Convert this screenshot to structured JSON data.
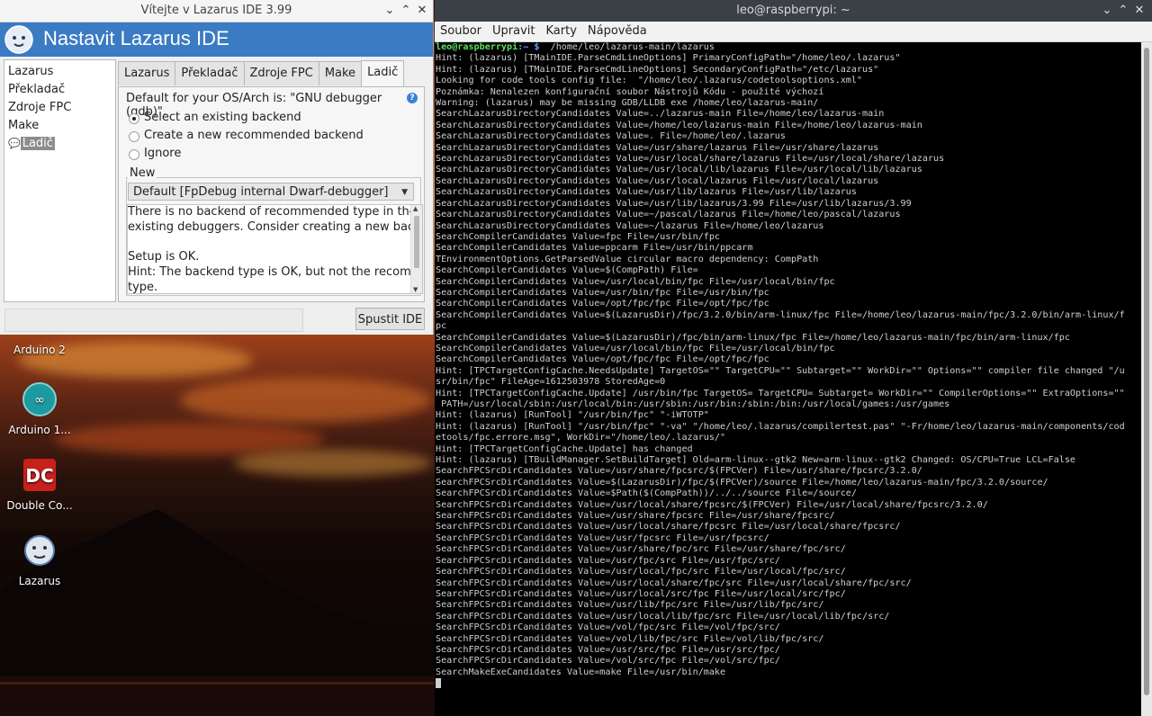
{
  "desktop": {
    "icons": [
      {
        "label": "Arduino 2",
        "icon": "arduino-icon"
      },
      {
        "label": "Arduino 1...",
        "icon": "arduino-icon"
      },
      {
        "label": "Double Co...",
        "icon": "double-commander-icon"
      },
      {
        "label": "Lazarus",
        "icon": "lazarus-cheetah-icon"
      }
    ]
  },
  "lazarus": {
    "window_title": "Vítejte v Lazarus IDE 3.99",
    "header_title": "Nastavit Lazarus IDE",
    "tree": [
      "Lazarus",
      "Překladač",
      "Zdroje FPC",
      "Make",
      "Ladič"
    ],
    "tabs": [
      "Lazarus",
      "Překladač",
      "Zdroje FPC",
      "Make",
      "Ladič"
    ],
    "default_debugger_text": "Default for your OS/Arch is: \"GNU debugger (gdb)\".",
    "radio_options": [
      "Select an existing backend",
      "Create a new recommended backend",
      "Ignore"
    ],
    "selected_radio": 0,
    "new_label": "New",
    "combo_value": "Default [FpDebug internal Dwarf-debugger]",
    "memo_lines": [
      "There is no backend of recommended type in the list of",
      "existing debuggers. Consider creating a new backend.",
      "",
      "Setup is OK.",
      "Hint: The backend type is OK, but not the recommended",
      "type."
    ],
    "run_button": "Spustit IDE",
    "colors": {
      "header_bg": "#3a7bc3",
      "help_icon": "#3b82d6"
    }
  },
  "terminal": {
    "window_title": "leo@raspberrypi: ~",
    "menu": [
      "Soubor",
      "Upravit",
      "Karty",
      "Nápověda"
    ],
    "prompt_user": "leo@raspberrypi",
    "prompt_dir": ":~ $",
    "command": "/home/leo/lazarus-main/lazarus",
    "lines": [
      "Hint: (lazarus) [TMainIDE.ParseCmdLineOptions] PrimaryConfigPath=\"/home/leo/.lazarus\"",
      "Hint: (lazarus) [TMainIDE.ParseCmdLineOptions] SecondaryConfigPath=\"/etc/lazarus\"",
      "Looking for code tools config file:  \"/home/leo/.lazarus/codetoolsoptions.xml\"",
      "Poznámka: Nenalezen konfigurační soubor Nástrojů Kódu - použité výchozí",
      "Warning: (lazarus) may be missing GDB/LLDB exe /home/leo/lazarus-main/",
      "SearchLazarusDirectoryCandidates Value=../lazarus-main File=/home/leo/lazarus-main",
      "SearchLazarusDirectoryCandidates Value=/home/leo/lazarus-main File=/home/leo/lazarus-main",
      "SearchLazarusDirectoryCandidates Value=. File=/home/leo/.lazarus",
      "SearchLazarusDirectoryCandidates Value=/usr/share/lazarus File=/usr/share/lazarus",
      "SearchLazarusDirectoryCandidates Value=/usr/local/share/lazarus File=/usr/local/share/lazarus",
      "SearchLazarusDirectoryCandidates Value=/usr/local/lib/lazarus File=/usr/local/lib/lazarus",
      "SearchLazarusDirectoryCandidates Value=/usr/local/lazarus File=/usr/local/lazarus",
      "SearchLazarusDirectoryCandidates Value=/usr/lib/lazarus File=/usr/lib/lazarus",
      "SearchLazarusDirectoryCandidates Value=/usr/lib/lazarus/3.99 File=/usr/lib/lazarus/3.99",
      "SearchLazarusDirectoryCandidates Value=~/pascal/lazarus File=/home/leo/pascal/lazarus",
      "SearchLazarusDirectoryCandidates Value=~/lazarus File=/home/leo/lazarus",
      "SearchCompilerCandidates Value=fpc File=/usr/bin/fpc",
      "SearchCompilerCandidates Value=ppcarm File=/usr/bin/ppcarm",
      "TEnvironmentOptions.GetParsedValue circular macro dependency: CompPath",
      "SearchCompilerCandidates Value=$(CompPath) File=",
      "SearchCompilerCandidates Value=/usr/local/bin/fpc File=/usr/local/bin/fpc",
      "SearchCompilerCandidates Value=/usr/bin/fpc File=/usr/bin/fpc",
      "SearchCompilerCandidates Value=/opt/fpc/fpc File=/opt/fpc/fpc",
      "SearchCompilerCandidates Value=$(LazarusDir)/fpc/3.2.0/bin/arm-linux/fpc File=/home/leo/lazarus-main/fpc/3.2.0/bin/arm-linux/f",
      "pc",
      "SearchCompilerCandidates Value=$(LazarusDir)/fpc/bin/arm-linux/fpc File=/home/leo/lazarus-main/fpc/bin/arm-linux/fpc",
      "SearchCompilerCandidates Value=/usr/local/bin/fpc File=/usr/local/bin/fpc",
      "SearchCompilerCandidates Value=/opt/fpc/fpc File=/opt/fpc/fpc",
      "Hint: [TPCTargetConfigCache.NeedsUpdate] TargetOS=\"\" TargetCPU=\"\" Subtarget=\"\" WorkDir=\"\" Options=\"\" compiler file changed \"/u",
      "sr/bin/fpc\" FileAge=1612503978 StoredAge=0",
      "Hint: [TPCTargetConfigCache.Update] /usr/bin/fpc TargetOS= TargetCPU= Subtarget= WorkDir=\"\" CompilerOptions=\"\" ExtraOptions=\"\"",
      " PATH=/usr/local/sbin:/usr/local/bin:/usr/sbin:/usr/bin:/sbin:/bin:/usr/local/games:/usr/games",
      "Hint: (lazarus) [RunTool] \"/usr/bin/fpc\" \"-iWTOTP\"",
      "Hint: (lazarus) [RunTool] \"/usr/bin/fpc\" \"-va\" \"/home/leo/.lazarus/compilertest.pas\" \"-Fr/home/leo/lazarus-main/components/cod",
      "etools/fpc.errore.msg\", WorkDir=\"/home/leo/.lazarus/\"",
      "Hint: [TPCTargetConfigCache.Update] has changed",
      "Hint: (lazarus) [TBuildManager.SetBuildTarget] Old=arm-linux--gtk2 New=arm-linux--gtk2 Changed: OS/CPU=True LCL=False",
      "SearchFPCSrcDirCandidates Value=/usr/share/fpcsrc/$(FPCVer) File=/usr/share/fpcsrc/3.2.0/",
      "SearchFPCSrcDirCandidates Value=$(LazarusDir)/fpc/$(FPCVer)/source File=/home/leo/lazarus-main/fpc/3.2.0/source/",
      "SearchFPCSrcDirCandidates Value=$Path($(CompPath))/../../source File=/source/",
      "SearchFPCSrcDirCandidates Value=/usr/local/share/fpcsrc/$(FPCVer) File=/usr/local/share/fpcsrc/3.2.0/",
      "SearchFPCSrcDirCandidates Value=/usr/share/fpcsrc File=/usr/share/fpcsrc/",
      "SearchFPCSrcDirCandidates Value=/usr/local/share/fpcsrc File=/usr/local/share/fpcsrc/",
      "SearchFPCSrcDirCandidates Value=/usr/fpcsrc File=/usr/fpcsrc/",
      "SearchFPCSrcDirCandidates Value=/usr/share/fpc/src File=/usr/share/fpc/src/",
      "SearchFPCSrcDirCandidates Value=/usr/fpc/src File=/usr/fpc/src/",
      "SearchFPCSrcDirCandidates Value=/usr/local/fpc/src File=/usr/local/fpc/src/",
      "SearchFPCSrcDirCandidates Value=/usr/local/share/fpc/src File=/usr/local/share/fpc/src/",
      "SearchFPCSrcDirCandidates Value=/usr/local/src/fpc File=/usr/local/src/fpc/",
      "SearchFPCSrcDirCandidates Value=/usr/lib/fpc/src File=/usr/lib/fpc/src/",
      "SearchFPCSrcDirCandidates Value=/usr/local/lib/fpc/src File=/usr/local/lib/fpc/src/",
      "SearchFPCSrcDirCandidates Value=/vol/fpc/src File=/vol/fpc/src/",
      "SearchFPCSrcDirCandidates Value=/vol/lib/fpc/src File=/vol/lib/fpc/src/",
      "SearchFPCSrcDirCandidates Value=/usr/src/fpc File=/usr/src/fpc/",
      "SearchFPCSrcDirCandidates Value=/vol/src/fpc File=/vol/src/fpc/",
      "SearchMakeExeCandidates Value=make File=/usr/bin/make"
    ],
    "colors": {
      "prompt_user": "#5de05d",
      "prompt_dir": "#6a9cf0",
      "text": "#cfcfcf"
    }
  }
}
